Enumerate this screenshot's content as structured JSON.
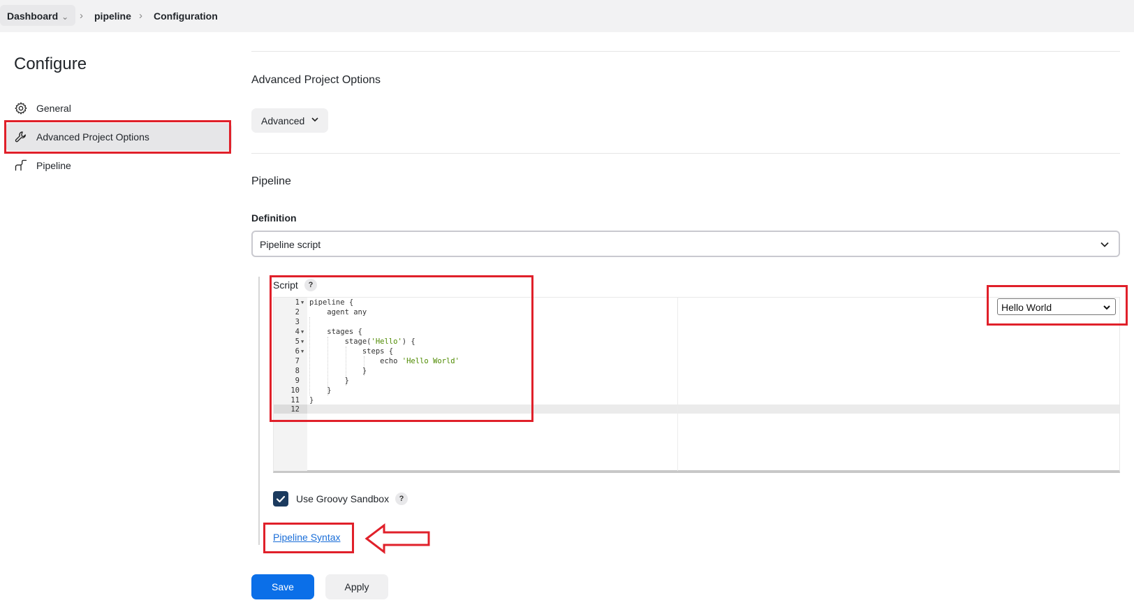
{
  "breadcrumb": {
    "items": [
      "Dashboard",
      "pipeline",
      "Configuration"
    ]
  },
  "sidebar": {
    "title": "Configure",
    "items": [
      {
        "label": "General",
        "icon": "gear-icon"
      },
      {
        "label": "Advanced Project Options",
        "icon": "wrench-icon",
        "active": true
      },
      {
        "label": "Pipeline",
        "icon": "pipeline-icon"
      }
    ]
  },
  "main": {
    "advanced_section": {
      "title": "Advanced Project Options",
      "button_label": "Advanced"
    },
    "pipeline_section": {
      "title": "Pipeline",
      "definition_label": "Definition",
      "definition_value": "Pipeline script",
      "script_label": "Script",
      "help": "?",
      "sample_select_value": "Hello World",
      "code_lines": [
        "pipeline {",
        "    agent any",
        "",
        "    stages {",
        "        stage(",
        "            steps {",
        "                echo ",
        "            }",
        "        }",
        "    }",
        "}",
        ""
      ],
      "code_strings": {
        "line5": "'Hello'",
        "line5_tail": ") {",
        "line7": "'Hello World'"
      },
      "sandbox_label": "Use Groovy Sandbox",
      "sandbox_checked": true,
      "syntax_link": "Pipeline Syntax"
    },
    "actions": {
      "save": "Save",
      "apply": "Apply"
    }
  },
  "colors": {
    "accent": "#0b6fe8",
    "annotation_red": "#e0202a",
    "code_string": "#4e8a00",
    "checkbox": "#1b3a5e"
  }
}
